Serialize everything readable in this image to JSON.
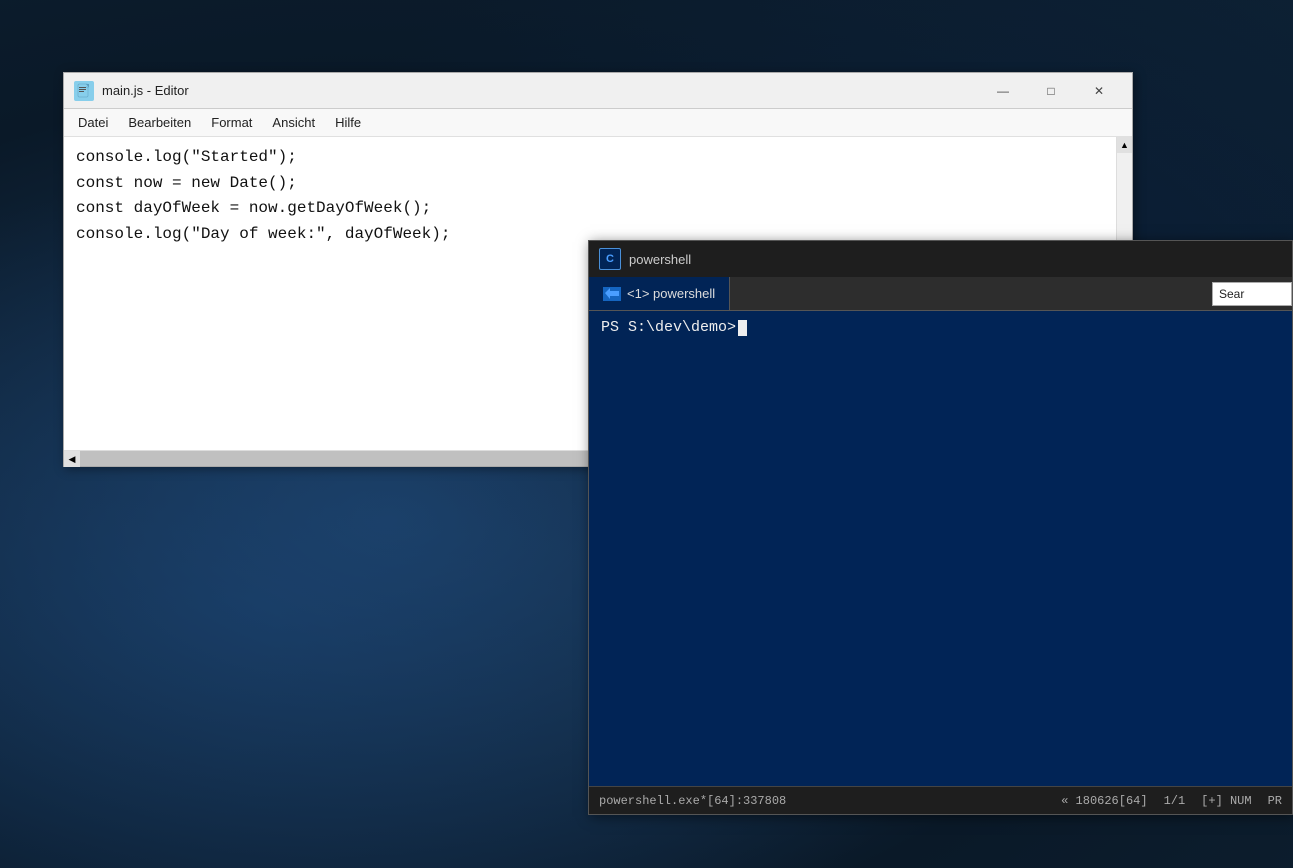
{
  "editor": {
    "title": "main.js - Editor",
    "icon_text": "📄",
    "menu_items": [
      "Datei",
      "Bearbeiten",
      "Format",
      "Ansicht",
      "Hilfe"
    ],
    "code_lines": [
      "console.log(\"Started\");",
      "const now = new Date();",
      "const dayOfWeek = now.getDayOfWeek();",
      "console.log(\"Day of week:\", dayOfWeek);"
    ],
    "minimize_label": "—",
    "maximize_label": "□",
    "close_label": "✕"
  },
  "powershell": {
    "title": "powershell",
    "tab_label": "<1> powershell",
    "prompt": "PS S:\\dev\\demo> ",
    "search_placeholder": "Sear",
    "status_left": "powershell.exe*[64]:337808",
    "status_middle": "« 180626[64]",
    "status_page": "1/1",
    "status_num": "[+] NUM",
    "status_extra": "PR"
  },
  "colors": {
    "desktop_bg": "#0d2137",
    "editor_bg": "#ffffff",
    "editor_titlebar": "#f0f0f0",
    "editor_menubar": "#f8f8f8",
    "ps_bg": "#012456",
    "ps_titlebar": "#1e1e1e",
    "ps_tabbar": "#2d2d2d",
    "ps_status": "#1e1e1e"
  }
}
